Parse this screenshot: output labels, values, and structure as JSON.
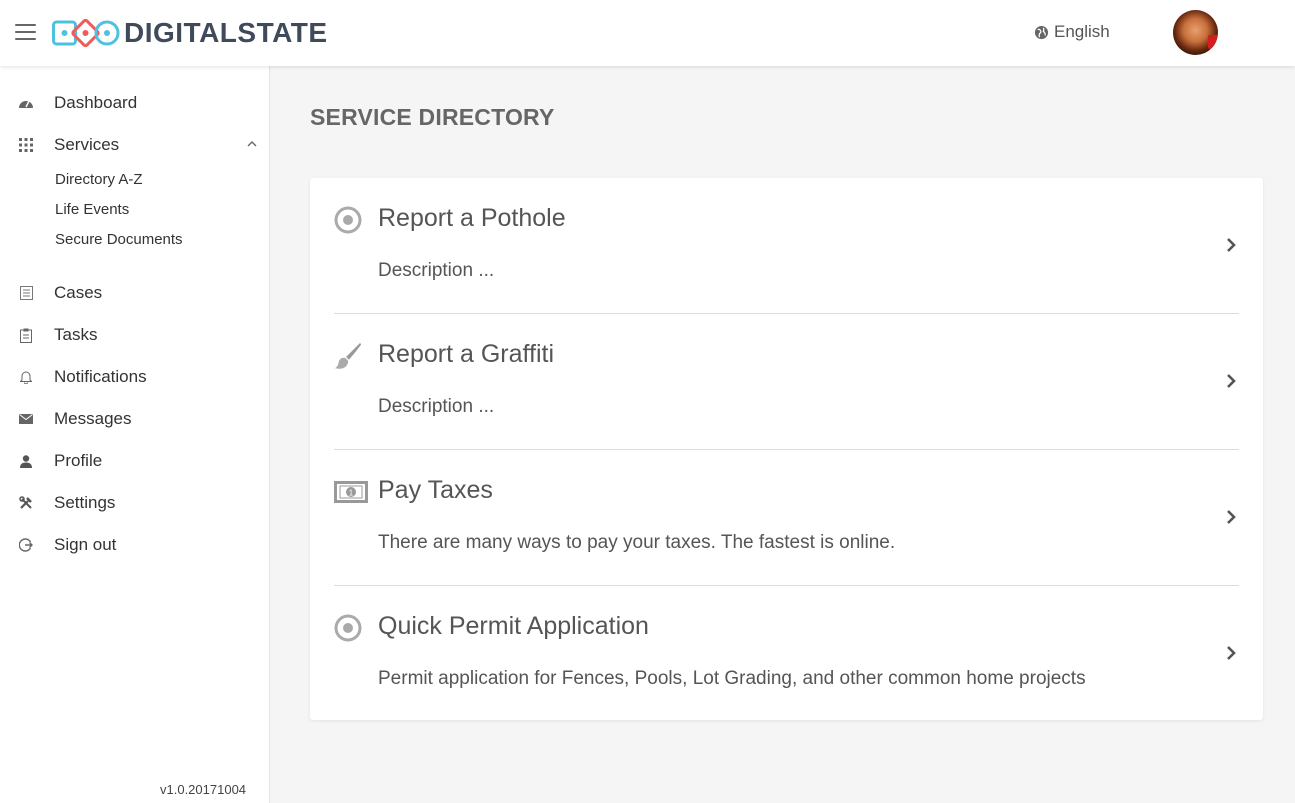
{
  "header": {
    "brand": "DIGITALSTATE",
    "language": "English",
    "menu_icon": "hamburger-icon",
    "language_icon": "globe-icon",
    "brand_colors": {
      "teal": "#4fc1e0",
      "coral": "#ef5a5a",
      "navy": "#3f4a5a"
    }
  },
  "sidebar": {
    "items": [
      {
        "label": "Dashboard",
        "icon": "dashboard-icon"
      },
      {
        "label": "Services",
        "icon": "grid-icon",
        "expanded": true,
        "children": [
          {
            "label": "Directory A-Z"
          },
          {
            "label": "Life Events"
          },
          {
            "label": "Secure Documents"
          }
        ]
      },
      {
        "label": "Cases",
        "icon": "list-icon"
      },
      {
        "label": "Tasks",
        "icon": "clipboard-icon"
      },
      {
        "label": "Notifications",
        "icon": "bell-icon"
      },
      {
        "label": "Messages",
        "icon": "envelope-icon"
      },
      {
        "label": "Profile",
        "icon": "user-icon"
      },
      {
        "label": "Settings",
        "icon": "tools-icon"
      },
      {
        "label": "Sign out",
        "icon": "sign-out-icon"
      }
    ],
    "version": "v1.0.20171004"
  },
  "main": {
    "title": "SERVICE DIRECTORY",
    "services": [
      {
        "title": "Report a Pothole",
        "description": "Description ...",
        "icon": "target-icon"
      },
      {
        "title": "Report a Graffiti",
        "description": "Description ...",
        "icon": "paint-brush-icon"
      },
      {
        "title": "Pay Taxes",
        "description": "There are many ways to pay your taxes. The fastest is online.",
        "icon": "money-bill-icon"
      },
      {
        "title": "Quick Permit Application",
        "description": "Permit application for Fences, Pools, Lot Grading, and other common home projects",
        "icon": "target-icon"
      }
    ]
  }
}
